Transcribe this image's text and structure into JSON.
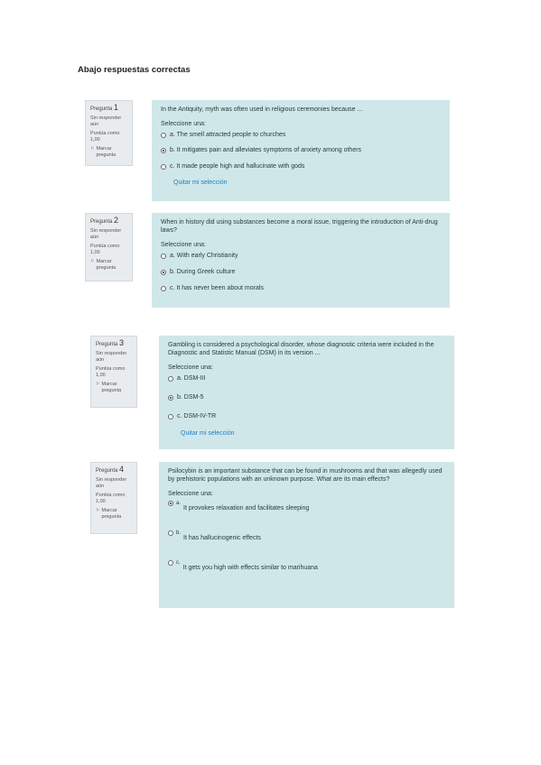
{
  "page_title": "Abajo respuestas correctas",
  "questions": [
    {
      "label": "Pregunta",
      "number": "1",
      "status": "Sin responder aún",
      "score": "Puntúa como 1,00",
      "flag": "Marcar pregunta",
      "text": "In the Antiquity, myth was often used in religious ceremonies because ...",
      "prompt": "Seleccione una:",
      "options": [
        {
          "text": "a. The smell attracted people to churches",
          "selected": false
        },
        {
          "text": "b. It mitigates pain and alleviates symptoms of anxiety among others",
          "selected": true
        },
        {
          "text": "c. It made people high and hallucinate with gods",
          "selected": false
        }
      ],
      "clear": "Quitar mi selección"
    },
    {
      "label": "Pregunta",
      "number": "2",
      "status": "Sin responder aún",
      "score": "Puntúa como 1,00",
      "flag": "Marcar pregunta",
      "text": "When in history did using substances become a moral issue, triggering the introduction of Anti-drug laws?",
      "prompt": "Seleccione una:",
      "options": [
        {
          "text": "a. With early Christianity",
          "selected": false
        },
        {
          "text": "b. During Greek culture",
          "selected": true
        },
        {
          "text": "c. It has never been about morals",
          "selected": false
        }
      ],
      "clear": ""
    },
    {
      "label": "Pregunta",
      "number": "3",
      "status": "Sin responder aún",
      "score": "Puntúa como 1,00",
      "flag": "Marcar pregunta",
      "text": "Gambling is considered a psychological disorder, whose diagnostic criteria were included in the Diagnostic and Statistic Manual (DSM) in its version ...",
      "prompt": "Seleccione una:",
      "options": [
        {
          "text": "a. DSM-III",
          "selected": false
        },
        {
          "text": "b. DSM-5",
          "selected": true
        },
        {
          "text": "c. DSM-IV-TR",
          "selected": false
        }
      ],
      "clear": "Quitar mi selección"
    },
    {
      "label": "Pregunta",
      "number": "4",
      "status": "Sin responder aún",
      "score": "Puntúa como 1,00",
      "flag": "Marcar pregunta",
      "text": "Psilocybin is an important substance that can be found in mushrooms and that was allegedly used by prehistoric populations with an unknown purpose. What are its main effects?",
      "prompt": "Seleccione una:",
      "options": [
        {
          "letter": "a.",
          "text": "It provokes relaxation and facilitates sleeping",
          "selected": true
        },
        {
          "letter": "b.",
          "text": "It has hallucinogenic effects",
          "selected": false
        },
        {
          "letter": "c.",
          "text": "It gets you high with effects similar to marihuana",
          "selected": false
        }
      ]
    }
  ]
}
